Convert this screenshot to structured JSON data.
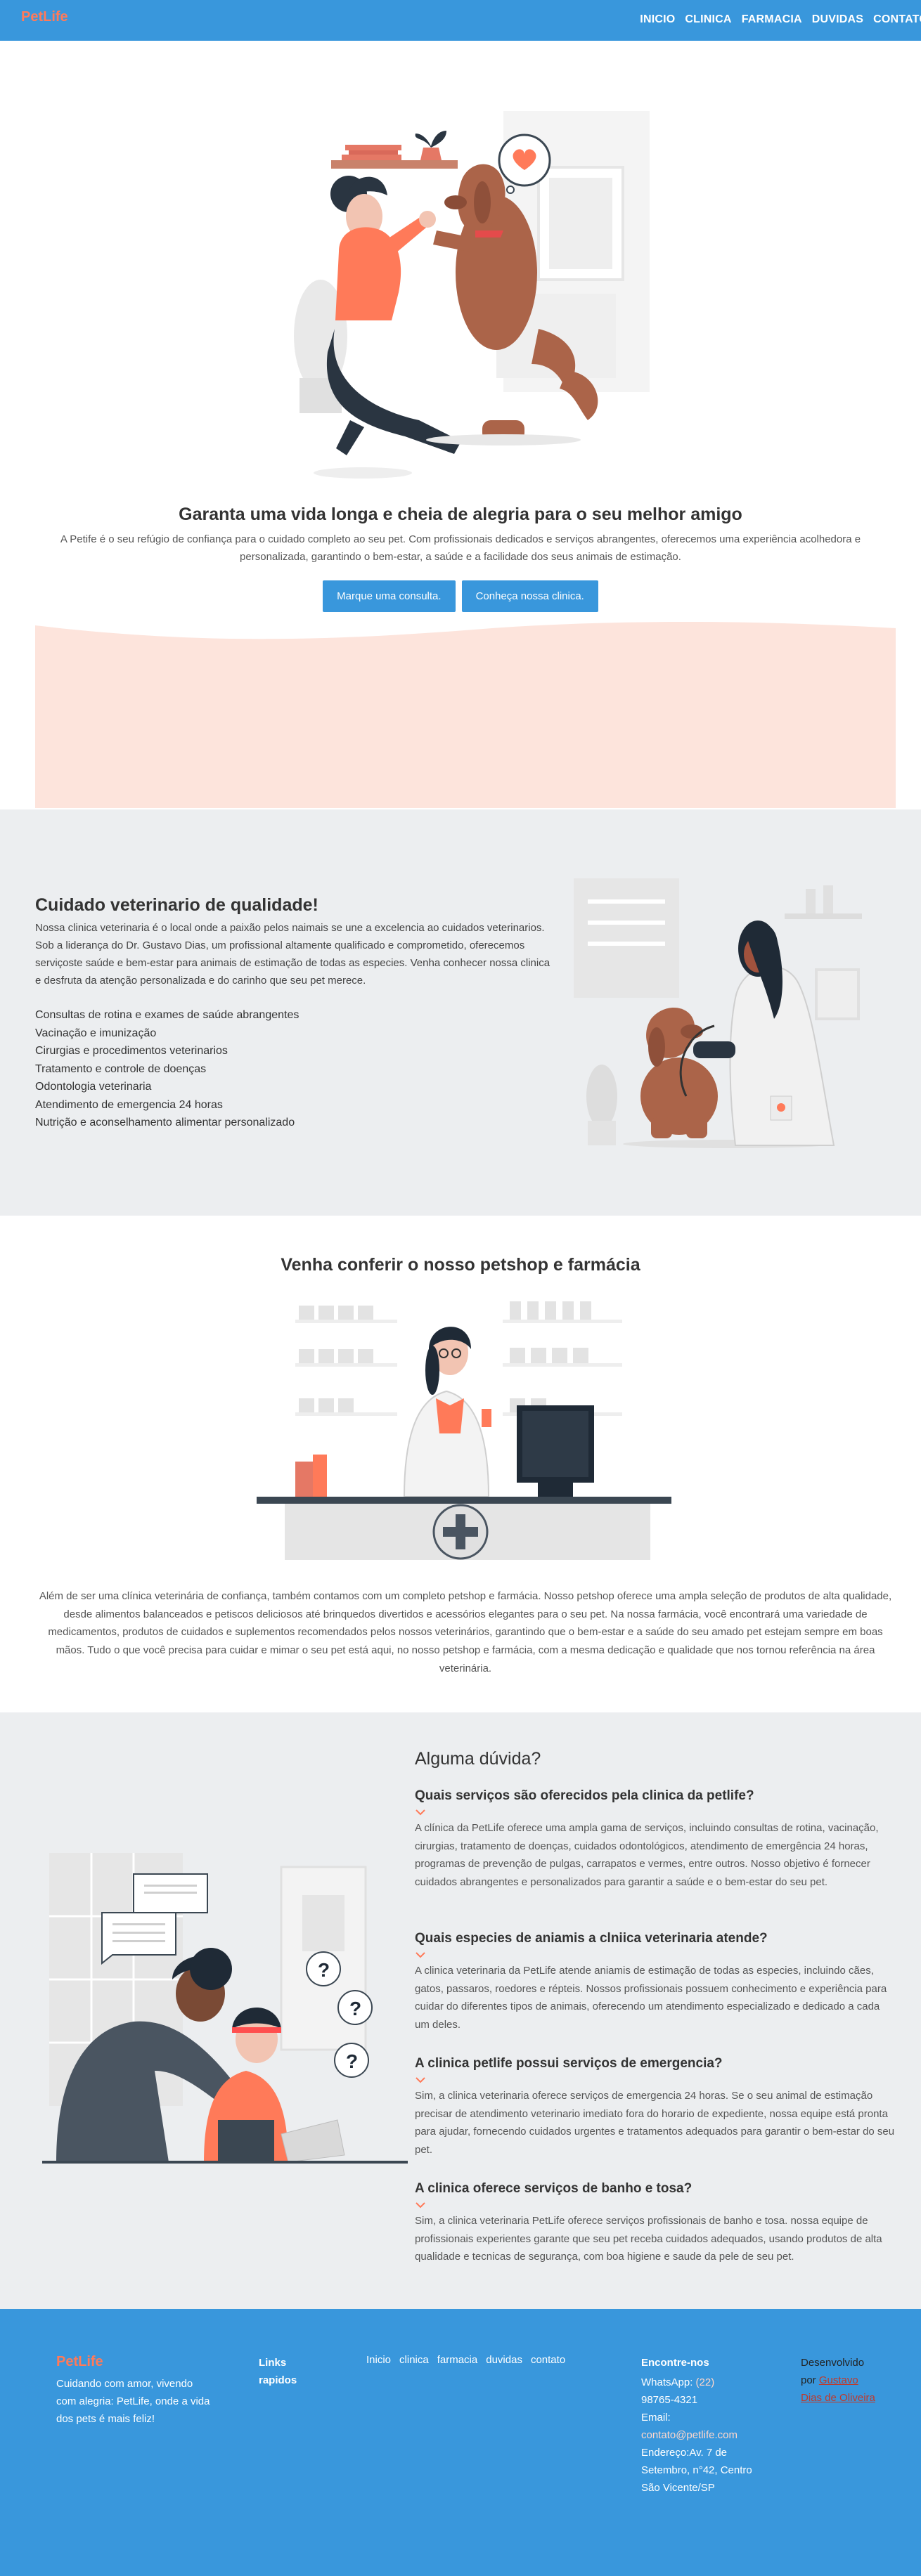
{
  "nav": {
    "brand": "PetLife",
    "links": [
      "INICIO",
      "CLINICA",
      "FARMACIA",
      "DUVIDAS",
      "CONTATO"
    ]
  },
  "hero": {
    "title": "Garanta uma vida longa e cheia de alegria para o seu melhor amigo",
    "text": "A Petife é o seu refúgio de confiança para o cuidado completo ao seu pet. Com profissionais dedicados e serviços abrangentes, oferecemos uma experiência acolhedora e personalizada, garantindo o bem-estar, a saúde e a facilidade dos seus animais de estimação.",
    "button_primary": "Marque uma consulta.",
    "button_secondary": "Conheça nossa clinica."
  },
  "care": {
    "title": "Cuidado veterinario de qualidade!",
    "text": "Nossa clinica veterinaria é o local onde a paixão pelos naimais se une a excelencia ao cuidados veterinarios. Sob a liderança do Dr. Gustavo Dias, um profissional altamente qualificado e comprometido, oferecemos serviçoste saúde e bem-estar para animais de estimação de todas as especies. Venha conhecer nossa clinica e desfruta da atenção personalizada e do carinho que seu pet merece.",
    "services": [
      "Consultas de rotina e exames de saúde abrangentes",
      "Vacinação e imunização",
      "Cirurgias e procedimentos veterinarios",
      "Tratamento e controle de doenças",
      "Odontologia veterinaria",
      "Atendimento de emergencia 24 horas",
      "Nutrição e aconselhamento alimentar personalizado"
    ]
  },
  "shop": {
    "title": "Venha conferir o nosso petshop e farmácia",
    "text": "Além de ser uma clínica veterinária de confiança, também contamos com um completo petshop e farmácia. Nosso petshop oferece uma ampla seleção de produtos de alta qualidade, desde alimentos balanceados e petiscos deliciosos até brinquedos divertidos e acessórios elegantes para o seu pet. Na nossa farmácia, você encontrará uma variedade de medicamentos, produtos de cuidados e suplementos recomendados pelos nossos veterinários, garantindo que o bem-estar e a saúde do seu amado pet estejam sempre em boas mãos. Tudo o que você precisa para cuidar e mimar o seu pet está aqui, no nosso petshop e farmácia, com a mesma dedicação e qualidade que nos tornou referência na área veterinária."
  },
  "faq": {
    "title": "Alguma dúvida?",
    "items": [
      {
        "q": "Quais serviços são oferecidos pela clinica da petlife?",
        "a": "A clínica da PetLife oferece uma ampla gama de serviços, incluindo consultas de rotina, vacinação, cirurgias, tratamento de doenças, cuidados odontológicos, atendimento de emergência 24 horas, programas de prevenção de pulgas, carrapatos e vermes, entre outros. Nosso objetivo é fornecer cuidados abrangentes e personalizados para garantir a saúde e o bem-estar do seu pet."
      },
      {
        "q": "Quais especies de aniamis a clniica veterinaria atende?",
        "a": "A clinica veterinaria da PetLife atende aniamis de estimação de todas as especies, incluindo cães, gatos, passaros, roedores e répteis. Nossos profissionais possuem conhecimento e experiência para cuidar do diferentes tipos de animais, oferecendo um atendimento especializado e dedicado a cada um deles."
      },
      {
        "q": "A clinica petlife possui serviços de emergencia?",
        "a": "Sim, a clinica veterinaria oferece serviços de emergencia 24 horas. Se o seu animal de estimação precisar de atendimento veterinario imediato fora do horario de expediente, nossa equipe está pronta para ajudar, fornecendo cuidados urgentes e tratamentos adequados para garantir o bem-estar do seu pet."
      },
      {
        "q": "A clinica oferece serviços de banho e tosa?",
        "a": "Sim, a clinica veterinaria PetLife oferece serviços profissionais de banho e tosa. nossa equipe de profissionais experientes garante que seu pet receba cuidados adequados, usando produtos de alta qualidade e tecnicas de segurança, com boa higiene e saude da pele de seu pet."
      }
    ]
  },
  "footer": {
    "brand": "PetLife",
    "tagline": "Cuidando com amor, vivendo com alegria: PetLife, onde a vida dos pets é mais feliz!",
    "links_heading": "Links rapidos",
    "links": [
      "Inicio",
      "clinica",
      "farmacia",
      "duvidas",
      "contato"
    ],
    "contact_heading": "Encontre-nos",
    "whatsapp_label": "WhatsApp:",
    "whatsapp_area": "(22)",
    "whatsapp_number": "98765-4321",
    "email_label": "Email:",
    "email": "contato@petlife.com",
    "address": "Endereço:Av. 7 de Setembro, n°42, Centro São Vicente/SP",
    "dev_prefix": "Desenvolvido por",
    "dev_name": "Gustavo Dias de Oliveira"
  },
  "colors": {
    "primary": "#3997dc",
    "accent": "#ff7a59",
    "section_gray": "#eceef0",
    "blush": "#fde4dc"
  }
}
